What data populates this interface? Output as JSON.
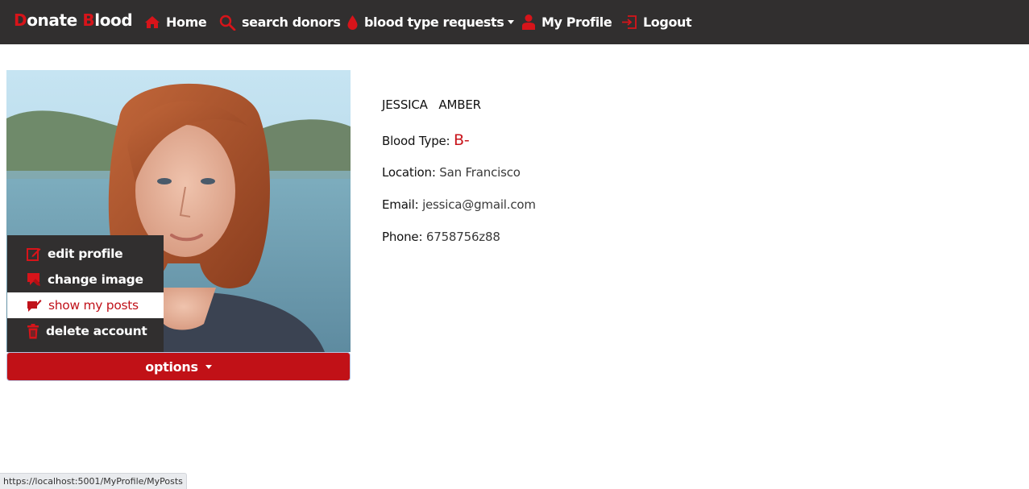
{
  "navbar": {
    "brand_first_letter": "D",
    "brand_middle": "onate ",
    "brand_second_letter": "B",
    "brand_rest": "lood",
    "items": [
      {
        "label": "Home",
        "icon": "home-icon"
      },
      {
        "label": "search donors",
        "icon": "search-icon"
      },
      {
        "label": "blood type requests",
        "icon": "blood-drop-icon",
        "has_caret": true
      },
      {
        "label": "My Profile",
        "icon": "user-icon"
      },
      {
        "label": "Logout",
        "icon": "logout-icon"
      }
    ]
  },
  "profile": {
    "first_name": "JESSICA",
    "last_name": "AMBER",
    "blood_type_label": "Blood Type:",
    "blood_type": "B-",
    "location_label": "Location:",
    "location": "San Francisco",
    "email_label": "Email:",
    "email": "jessica@gmail.com",
    "phone_label": "Phone:",
    "phone": "6758756z88"
  },
  "dropdown": {
    "items": [
      {
        "label": "edit profile",
        "icon": "edit-icon"
      },
      {
        "label": "change image",
        "icon": "image-icon"
      },
      {
        "label": "show my posts",
        "icon": "posts-icon",
        "active": true
      },
      {
        "label": "delete account",
        "icon": "trash-icon"
      }
    ]
  },
  "options_button": {
    "label": "options"
  },
  "statusbar": {
    "url": "https://localhost:5001/MyProfile/MyPosts"
  },
  "colors": {
    "brand_red": "#c11117",
    "navbar_bg": "#312f2f"
  }
}
